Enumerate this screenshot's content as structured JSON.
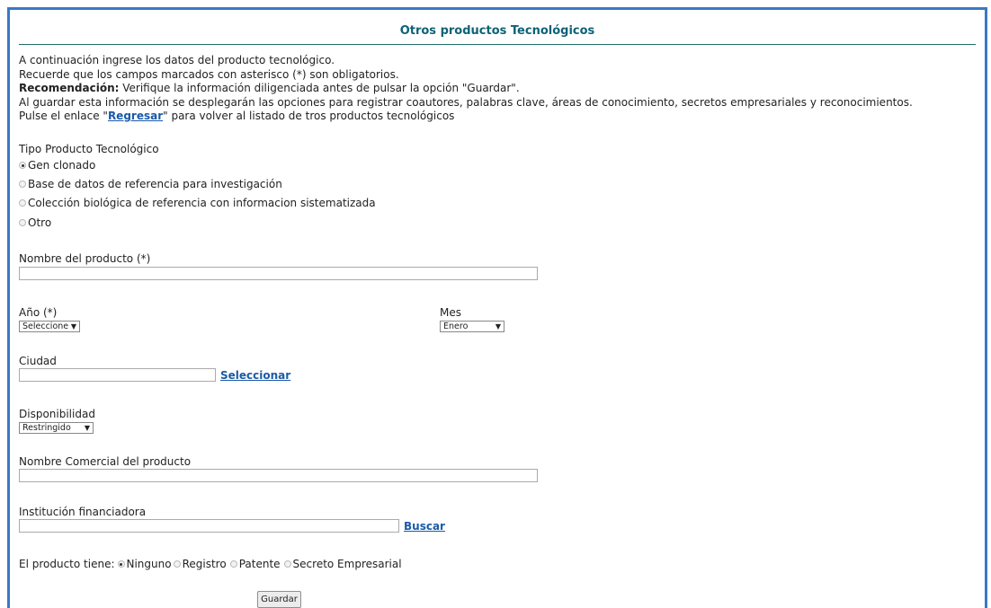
{
  "page": {
    "title": "Otros productos Tecnológicos"
  },
  "intro": {
    "line1": "A continuación ingrese los datos del producto tecnológico.",
    "line2": "Recuerde que los campos marcados con asterisco (*) son obligatorios.",
    "line3_bold": "Recomendación:",
    "line3_rest": " Verifique la información diligenciada antes de pulsar la opción \"Guardar\".",
    "line4": "Al guardar esta información se desplegarán las opciones para registrar coautores, palabras clave, áreas de conocimiento, secretos empresariales y reconocimientos.",
    "line5_pre": "Pulse el enlace \"",
    "line5_link": "Regresar",
    "line5_post": "\" para volver al listado de tros productos tecnológicos"
  },
  "tipo": {
    "label": "Tipo Producto Tecnológico",
    "options": [
      {
        "label": "Gen clonado",
        "checked": true
      },
      {
        "label": "Base de datos de referencia para investigación",
        "checked": false
      },
      {
        "label": "Colección biológica de referencia con informacion sistematizada",
        "checked": false
      },
      {
        "label": "Otro",
        "checked": false
      }
    ]
  },
  "nombre": {
    "label": "Nombre del producto (*)",
    "value": ""
  },
  "anio": {
    "label": "Año (*)",
    "selected": "Seleccione"
  },
  "mes": {
    "label": "Mes",
    "selected": "Enero"
  },
  "ciudad": {
    "label": "Ciudad",
    "value": "",
    "action": "Seleccionar"
  },
  "disponibilidad": {
    "label": "Disponibilidad",
    "selected": "Restringido"
  },
  "nombre_comercial": {
    "label": "Nombre Comercial del producto",
    "value": ""
  },
  "institucion": {
    "label": "Institución financiadora",
    "value": "",
    "action": "Buscar"
  },
  "producto_tiene": {
    "label": "El producto tiene:",
    "options": [
      {
        "label": "Ninguno",
        "checked": true
      },
      {
        "label": "Registro",
        "checked": false
      },
      {
        "label": "Patente",
        "checked": false
      },
      {
        "label": "Secreto Empresarial",
        "checked": false
      }
    ]
  },
  "actions": {
    "save": "Guardar"
  }
}
